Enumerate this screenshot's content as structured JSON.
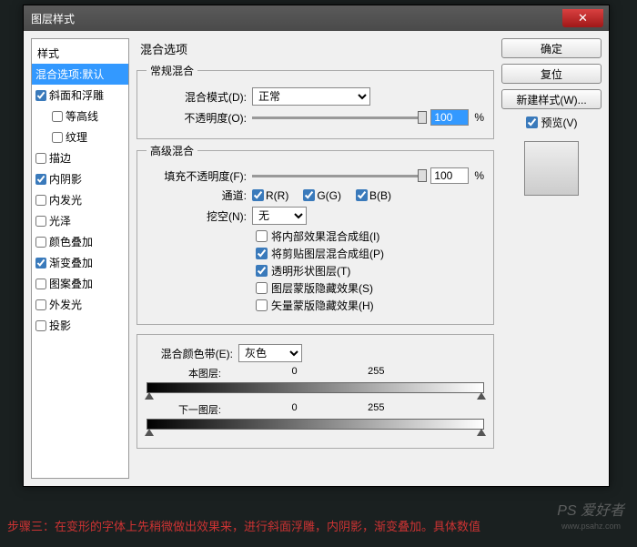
{
  "dialog": {
    "title": "图层样式",
    "close": "✕"
  },
  "sidebar": {
    "header": "样式",
    "items": [
      {
        "label": "混合选项:默认",
        "type": "selected"
      },
      {
        "label": "斜面和浮雕",
        "checked": true
      },
      {
        "label": "等高线",
        "checked": false,
        "indented": true
      },
      {
        "label": "纹理",
        "checked": false,
        "indented": true
      },
      {
        "label": "描边",
        "checked": false
      },
      {
        "label": "内阴影",
        "checked": true
      },
      {
        "label": "内发光",
        "checked": false
      },
      {
        "label": "光泽",
        "checked": false
      },
      {
        "label": "颜色叠加",
        "checked": false
      },
      {
        "label": "渐变叠加",
        "checked": true
      },
      {
        "label": "图案叠加",
        "checked": false
      },
      {
        "label": "外发光",
        "checked": false
      },
      {
        "label": "投影",
        "checked": false
      }
    ]
  },
  "main": {
    "title": "混合选项",
    "general": {
      "legend": "常规混合",
      "blend_mode_label": "混合模式(D):",
      "blend_mode_value": "正常",
      "opacity_label": "不透明度(O):",
      "opacity_value": "100",
      "percent": "%"
    },
    "advanced": {
      "legend": "高级混合",
      "fill_label": "填充不透明度(F):",
      "fill_value": "100",
      "percent": "%",
      "channels_label": "通道:",
      "ch_r": "R(R)",
      "ch_g": "G(G)",
      "ch_b": "B(B)",
      "knockout_label": "挖空(N):",
      "knockout_value": "无",
      "opts": [
        {
          "label": "将内部效果混合成组(I)",
          "checked": false
        },
        {
          "label": "将剪贴图层混合成组(P)",
          "checked": true
        },
        {
          "label": "透明形状图层(T)",
          "checked": true
        },
        {
          "label": "图层蒙版隐藏效果(S)",
          "checked": false
        },
        {
          "label": "矢量蒙版隐藏效果(H)",
          "checked": false
        }
      ]
    },
    "blendif": {
      "label": "混合颜色带(E):",
      "value": "灰色",
      "this_layer": "本图层:",
      "underlying": "下一图层:",
      "v0": "0",
      "v255": "255"
    }
  },
  "buttons": {
    "ok": "确定",
    "cancel": "复位",
    "new_style": "新建样式(W)...",
    "preview": "预览(V)"
  },
  "footer": "步骤三：在变形的字体上先稍微做出效果来，进行斜面浮雕，内阴影，渐变叠加。具体数值",
  "watermark": "PS 爱好者",
  "watermark_sub": "www.psahz.com"
}
